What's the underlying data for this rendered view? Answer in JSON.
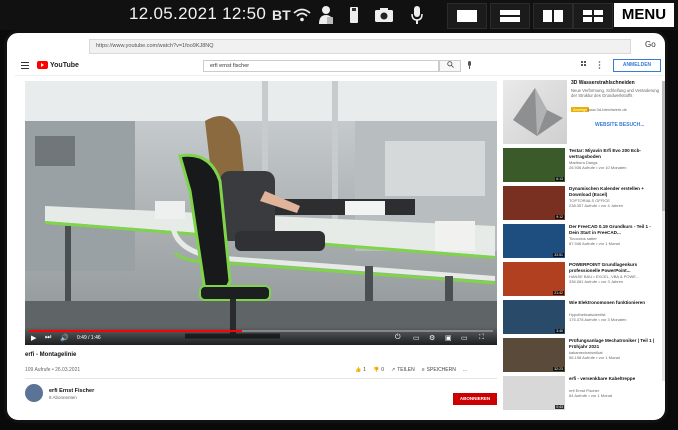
{
  "topbar": {
    "datetime": "12.05.2021 12:50",
    "bt_label": "BT",
    "menu_label": "MENU",
    "icons": [
      "wifi-icon",
      "person-icon",
      "sd-card-icon",
      "camera-icon",
      "microphone-icon"
    ],
    "layout_buttons": [
      "layout-full-icon",
      "layout-split-horizontal-icon",
      "layout-split-vertical-icon",
      "layout-quad-icon"
    ]
  },
  "browser": {
    "url": "https://www.youtube.com/watch?v=1foo9KJ8NQ",
    "go_label": "Go"
  },
  "youtube": {
    "logo_text": "YouTube",
    "search_value": "erfi ernst fischer",
    "signin_label": "ANMELDEN",
    "video": {
      "title": "erfi - Montagelinie",
      "views": "109 Aufrufe • 26.03.2021",
      "likes": "1",
      "dislikes": "0",
      "share_label": "TEILEN",
      "save_label": "SPEICHERN",
      "more_label": "...",
      "timecode": "0:49 / 1:46",
      "progress": 0.46
    },
    "channel": {
      "name": "erfi Ernst Fischer",
      "subs": "8 Abonnenten",
      "subscribe_label": "ABONNIEREN"
    },
    "ad": {
      "title": "3D Wasserstrahlschneiden",
      "desc": "Neue Verformung, Schleifung und Veränderung der Struktur des Grundwerkstoffs",
      "badge": "Anzeige",
      "source": "www.3d-bleichwerk.de",
      "visit_label": "WEBSITE BESUCH..."
    },
    "recommendations": [
      {
        "title": "Testar: Miyavin Erfi Evo 200 Ecb-vertragsboden",
        "channel": "Madhura Dangs",
        "views": "26.936 Aufrufe • vor 10 Monaten",
        "duration": "6:13",
        "color": "#3a5a2a"
      },
      {
        "title": "Dynamischen Kalender erstellen + Download (Excel)",
        "channel": "TOPTORIALS OFFICE",
        "views": "238.357 Aufrufe • vor 4 Jahren",
        "duration": "9:12",
        "color": "#7a3020"
      },
      {
        "title": "Der FreeCAD 0.19 Grundkurs - Teil 1 - Dein Start in FreeCAD...",
        "channel": "Tinoccios satter",
        "views": "87.946 Aufrufe • vor 1 Monat",
        "duration": "33:51",
        "color": "#1e4d80"
      },
      {
        "title": "POWERPOINT Grundlagenkurs professionelle PowerPoint...",
        "channel": "HANSE BAU • EXCEL, VBA & POWE...",
        "views": "336.081 Aufrufe • vor 3 Jahren",
        "duration": "21:42",
        "color": "#b04020"
      },
      {
        "title": "Wie Elektronomonen funktionieren",
        "channel": "Hypotheticalscientist",
        "views": "175.378 Aufrufe • vor 3 Monaten",
        "duration": "3:40",
        "color": "#2a4a6a"
      },
      {
        "title": "Prüfungsanlage Mechatroniker | Teil 1 | Frühjahr 2021",
        "channel": "kakamechatronikat",
        "views": "56.198 Aufrufe • vor 1 Monat",
        "duration": "32:23",
        "color": "#5a4a3a"
      },
      {
        "title": "erfi - versenkbare Kabeltreppe",
        "channel": "erfi Ernst Fischer",
        "views": "84 Aufrufe • vor 1 Monat",
        "duration": "0:43",
        "color": "#d8d8d8"
      }
    ]
  }
}
